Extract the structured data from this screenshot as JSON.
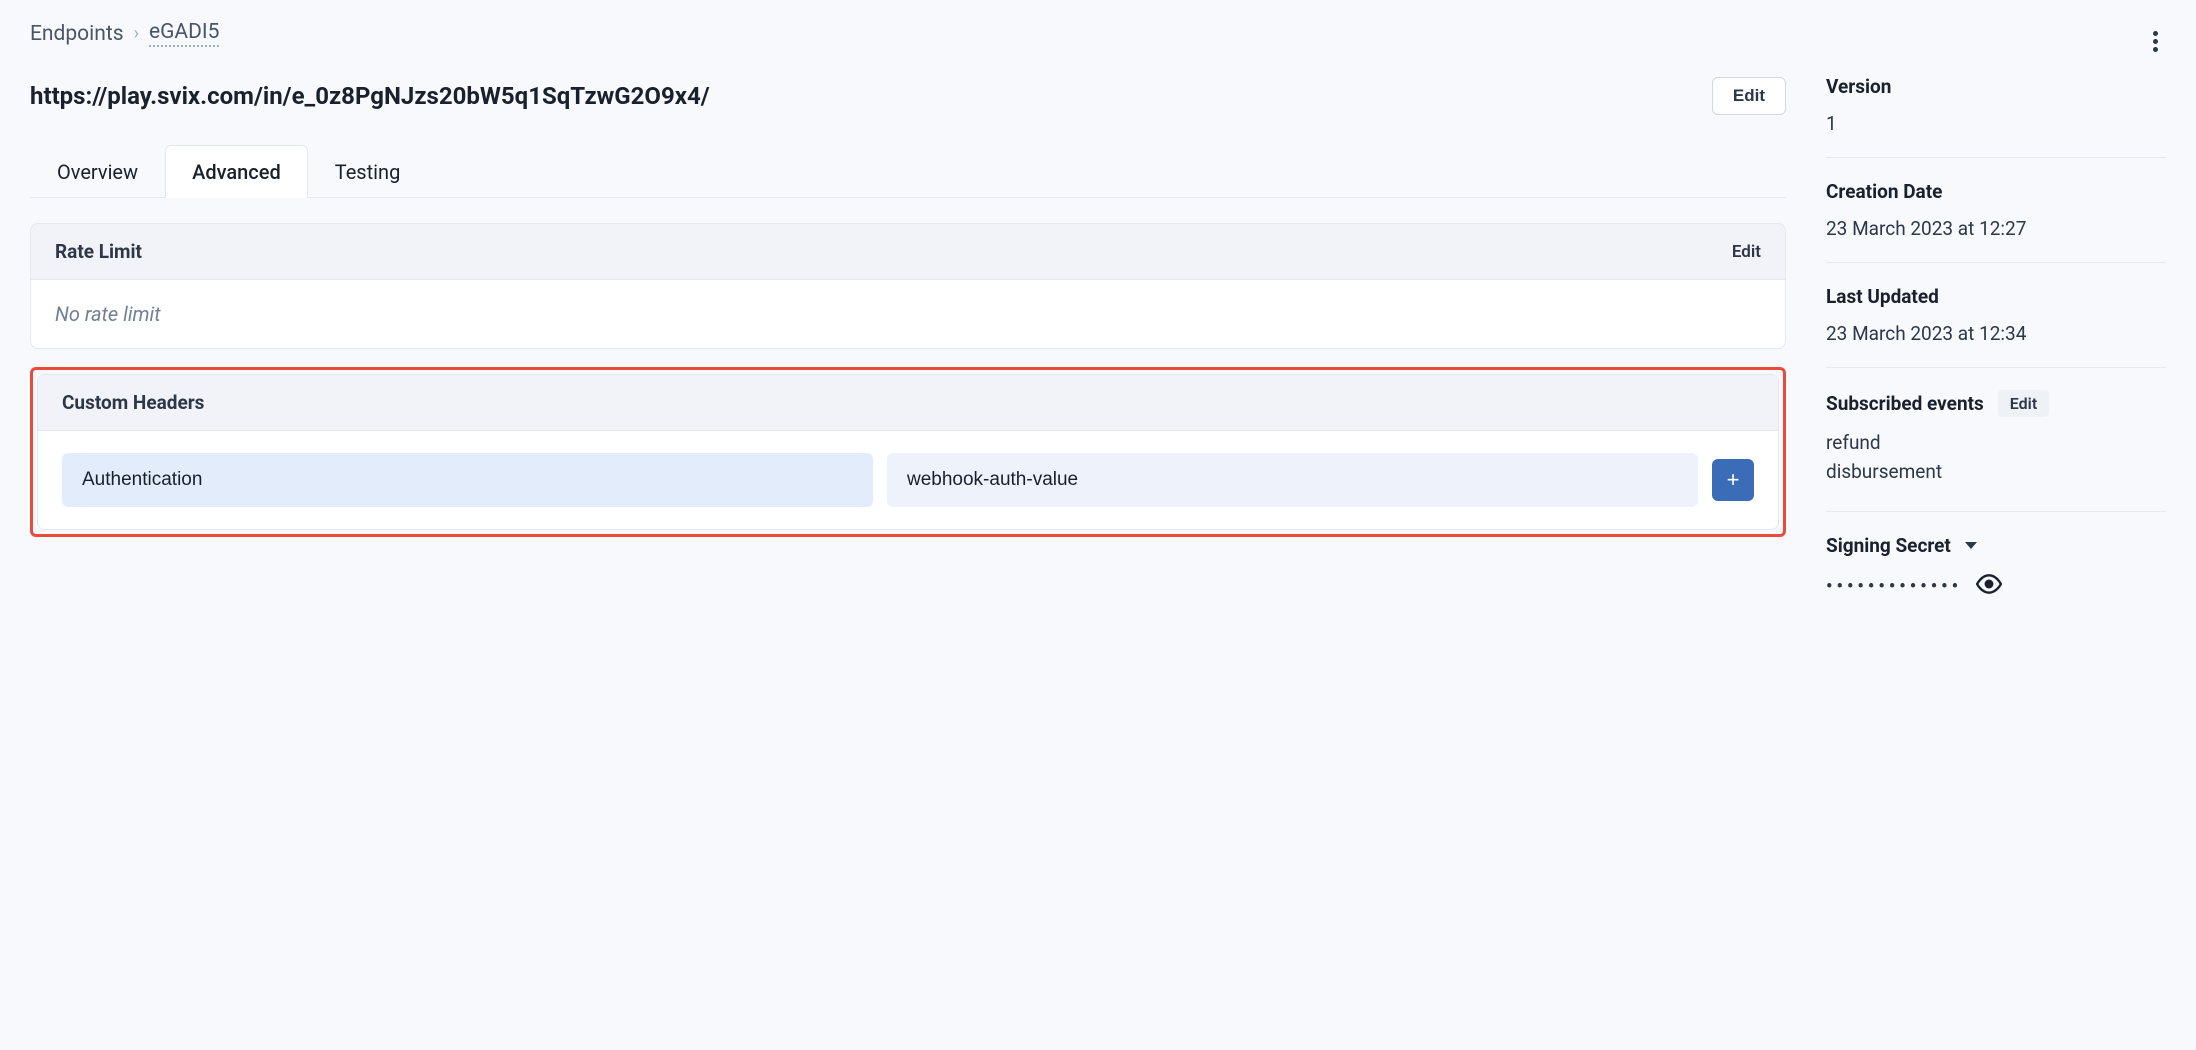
{
  "breadcrumb": {
    "root": "Endpoints",
    "current": "eGADI5"
  },
  "page_title": "https://play.svix.com/in/e_0z8PgNJzs20bW5q1SqTzwG2O9x4/",
  "edit_label": "Edit",
  "tabs": {
    "overview": "Overview",
    "advanced": "Advanced",
    "testing": "Testing"
  },
  "rate_limit": {
    "title": "Rate Limit",
    "edit_label": "Edit",
    "value": "No rate limit"
  },
  "custom_headers": {
    "title": "Custom Headers",
    "key": "Authentication",
    "value": "webhook-auth-value",
    "add_label": "+"
  },
  "sidebar": {
    "version_label": "Version",
    "version_value": "1",
    "creation_label": "Creation Date",
    "creation_value": "23 March 2023 at 12:27",
    "updated_label": "Last Updated",
    "updated_value": "23 March 2023 at 12:34",
    "events_label": "Subscribed events",
    "events_edit": "Edit",
    "events": [
      "refund",
      "disbursement"
    ],
    "signing_label": "Signing Secret",
    "signing_masked": "•••••••••••••"
  }
}
